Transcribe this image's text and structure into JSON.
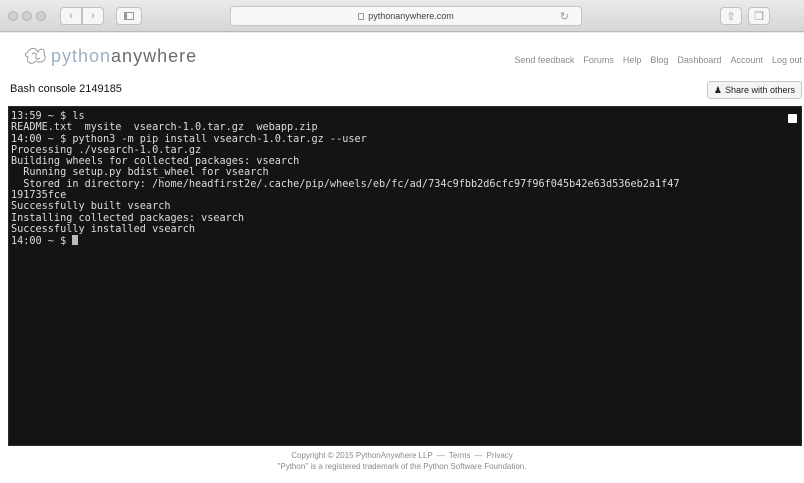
{
  "browser": {
    "url": "pythonanywhere.com",
    "back_icon": "chevron-left-icon",
    "forward_icon": "chevron-right-icon"
  },
  "brand": {
    "name_prefix": "python",
    "name_suffix": "anywhere"
  },
  "nav": {
    "items": [
      "Send feedback",
      "Forums",
      "Help",
      "Blog",
      "Dashboard",
      "Account",
      "Log out"
    ]
  },
  "console": {
    "title": "Bash console 2149185",
    "share_label": "Share with others",
    "lines": [
      "13:59 ~ $ ls",
      "README.txt  mysite  vsearch-1.0.tar.gz  webapp.zip",
      "14:00 ~ $ python3 -m pip install vsearch-1.0.tar.gz --user",
      "Processing ./vsearch-1.0.tar.gz",
      "Building wheels for collected packages: vsearch",
      "  Running setup.py bdist_wheel for vsearch",
      "  Stored in directory: /home/headfirst2e/.cache/pip/wheels/eb/fc/ad/734c9fbb2d6cfc97f96f045b42e63d536eb2a1f47",
      "191735fce",
      "Successfully built vsearch",
      "Installing collected packages: vsearch",
      "Successfully installed vsearch"
    ],
    "prompt": "14:00 ~ $ "
  },
  "footer": {
    "copyright": "Copyright © 2015 PythonAnywhere LLP",
    "sep1": "—",
    "terms": "Terms",
    "sep2": "—",
    "privacy": "Privacy",
    "trademark": "\"Python\" is a registered trademark of the Python Software Foundation."
  }
}
